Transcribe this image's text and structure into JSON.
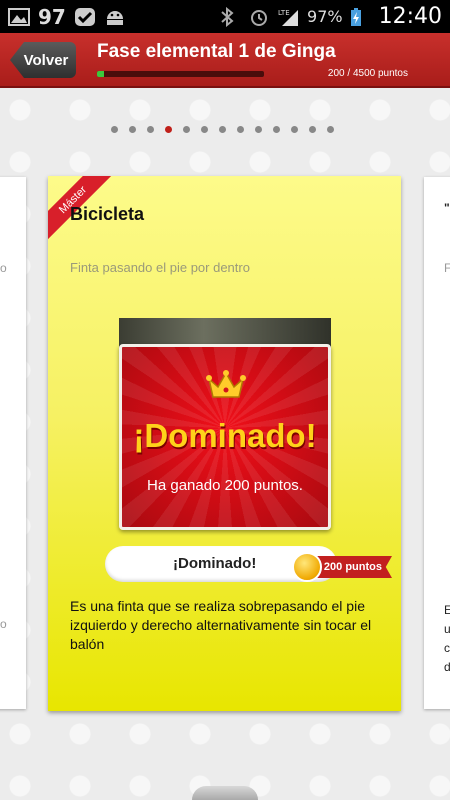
{
  "status_bar": {
    "notification_count": "97",
    "battery": "97%",
    "network": "LTE",
    "time": "12:40"
  },
  "header": {
    "back_label": "Volver",
    "title": "Fase elemental 1 de Ginga",
    "progress_text": "200 /  4500 puntos",
    "progress_fraction": 0.044
  },
  "pager": {
    "total": 13,
    "active_index": 3
  },
  "card": {
    "ribbon": "Máster",
    "title": "Bicicleta",
    "subtitle": "Finta pasando el pie por dentro",
    "mastered_title": "¡Dominado!",
    "mastered_subtitle": "Ha ganado 200 puntos.",
    "status_label": "¡Dominado!",
    "points_badge": "200 puntos",
    "description": "Es una finta que se realiza sobrepasando el pie izquierdo y derecho alternativamente sin tocar el balón"
  },
  "colors": {
    "header_red": "#c8302c",
    "card_yellow": "#f6f163",
    "mastered_red": "#d20c15",
    "gold": "#ffd21a"
  }
}
